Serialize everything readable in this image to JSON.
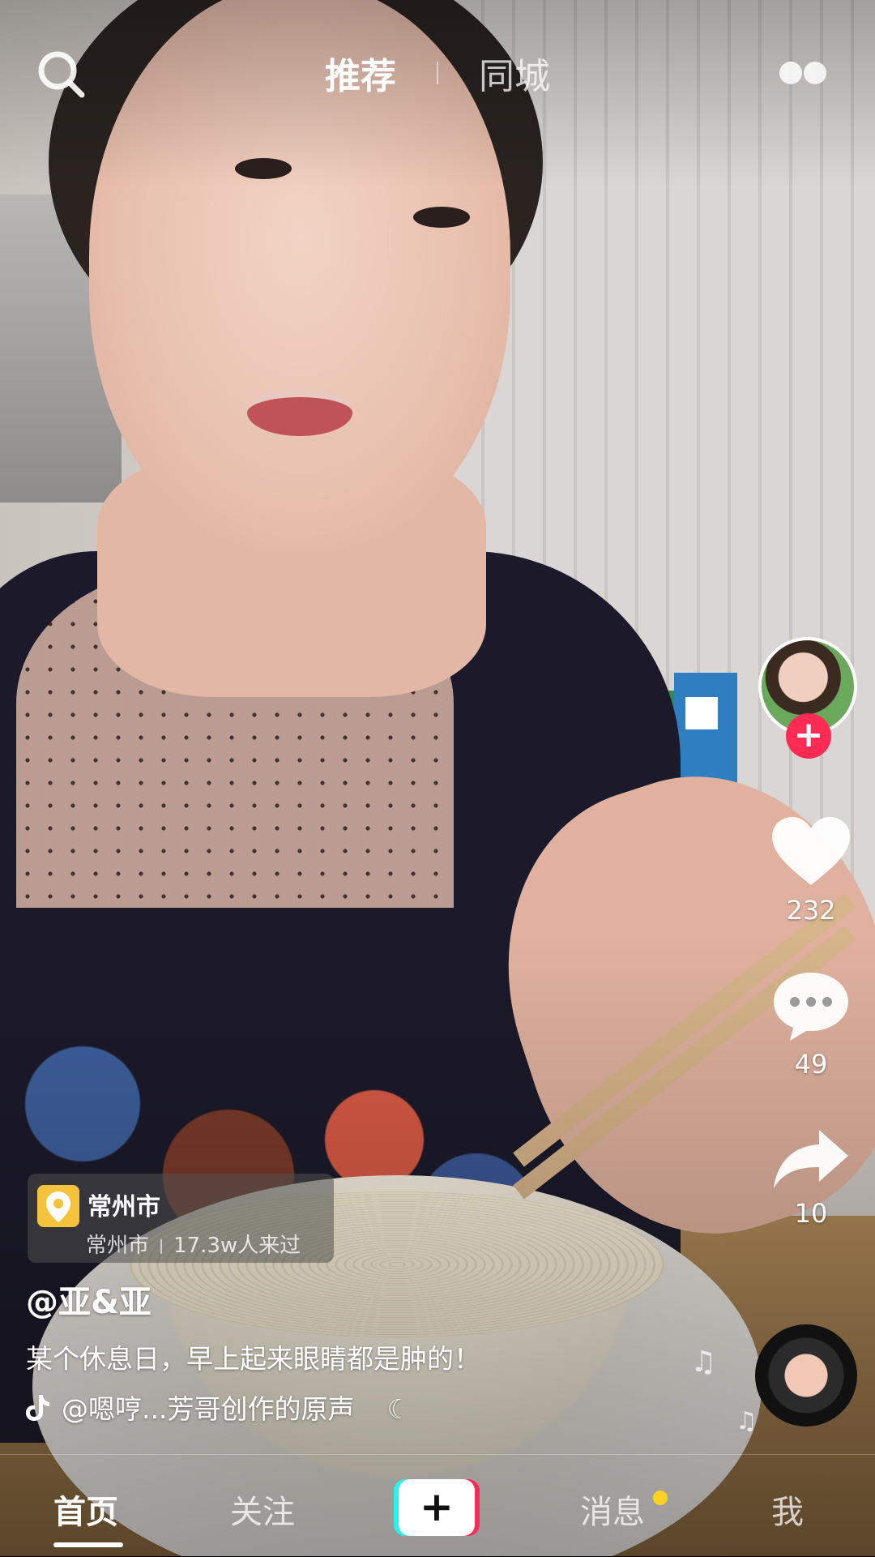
{
  "header": {
    "tabs": [
      {
        "label": "推荐",
        "active": true
      },
      {
        "label": "同城",
        "active": false
      }
    ],
    "icons": {
      "search": "search-icon",
      "more": "more-dots-icon"
    }
  },
  "side_actions": {
    "follow_symbol": "+",
    "likes": "232",
    "comments": "49",
    "shares": "10",
    "accent_color": "#fe2c55"
  },
  "location": {
    "title": "常州市",
    "city": "常州市",
    "visits": "17.3w人来过"
  },
  "caption": {
    "author": "@亚&亚",
    "text": "某个休息日，早上起来眼睛都是肿的！",
    "music": "@嗯哼...芳哥创作的原声"
  },
  "bottom_nav": {
    "items": [
      {
        "label": "首页",
        "active": true
      },
      {
        "label": "关注",
        "active": false
      },
      {
        "label": "消息",
        "active": false,
        "has_badge": true
      },
      {
        "label": "我",
        "active": false
      }
    ],
    "create_symbol": "+",
    "badge_color": "#fbd21d"
  }
}
